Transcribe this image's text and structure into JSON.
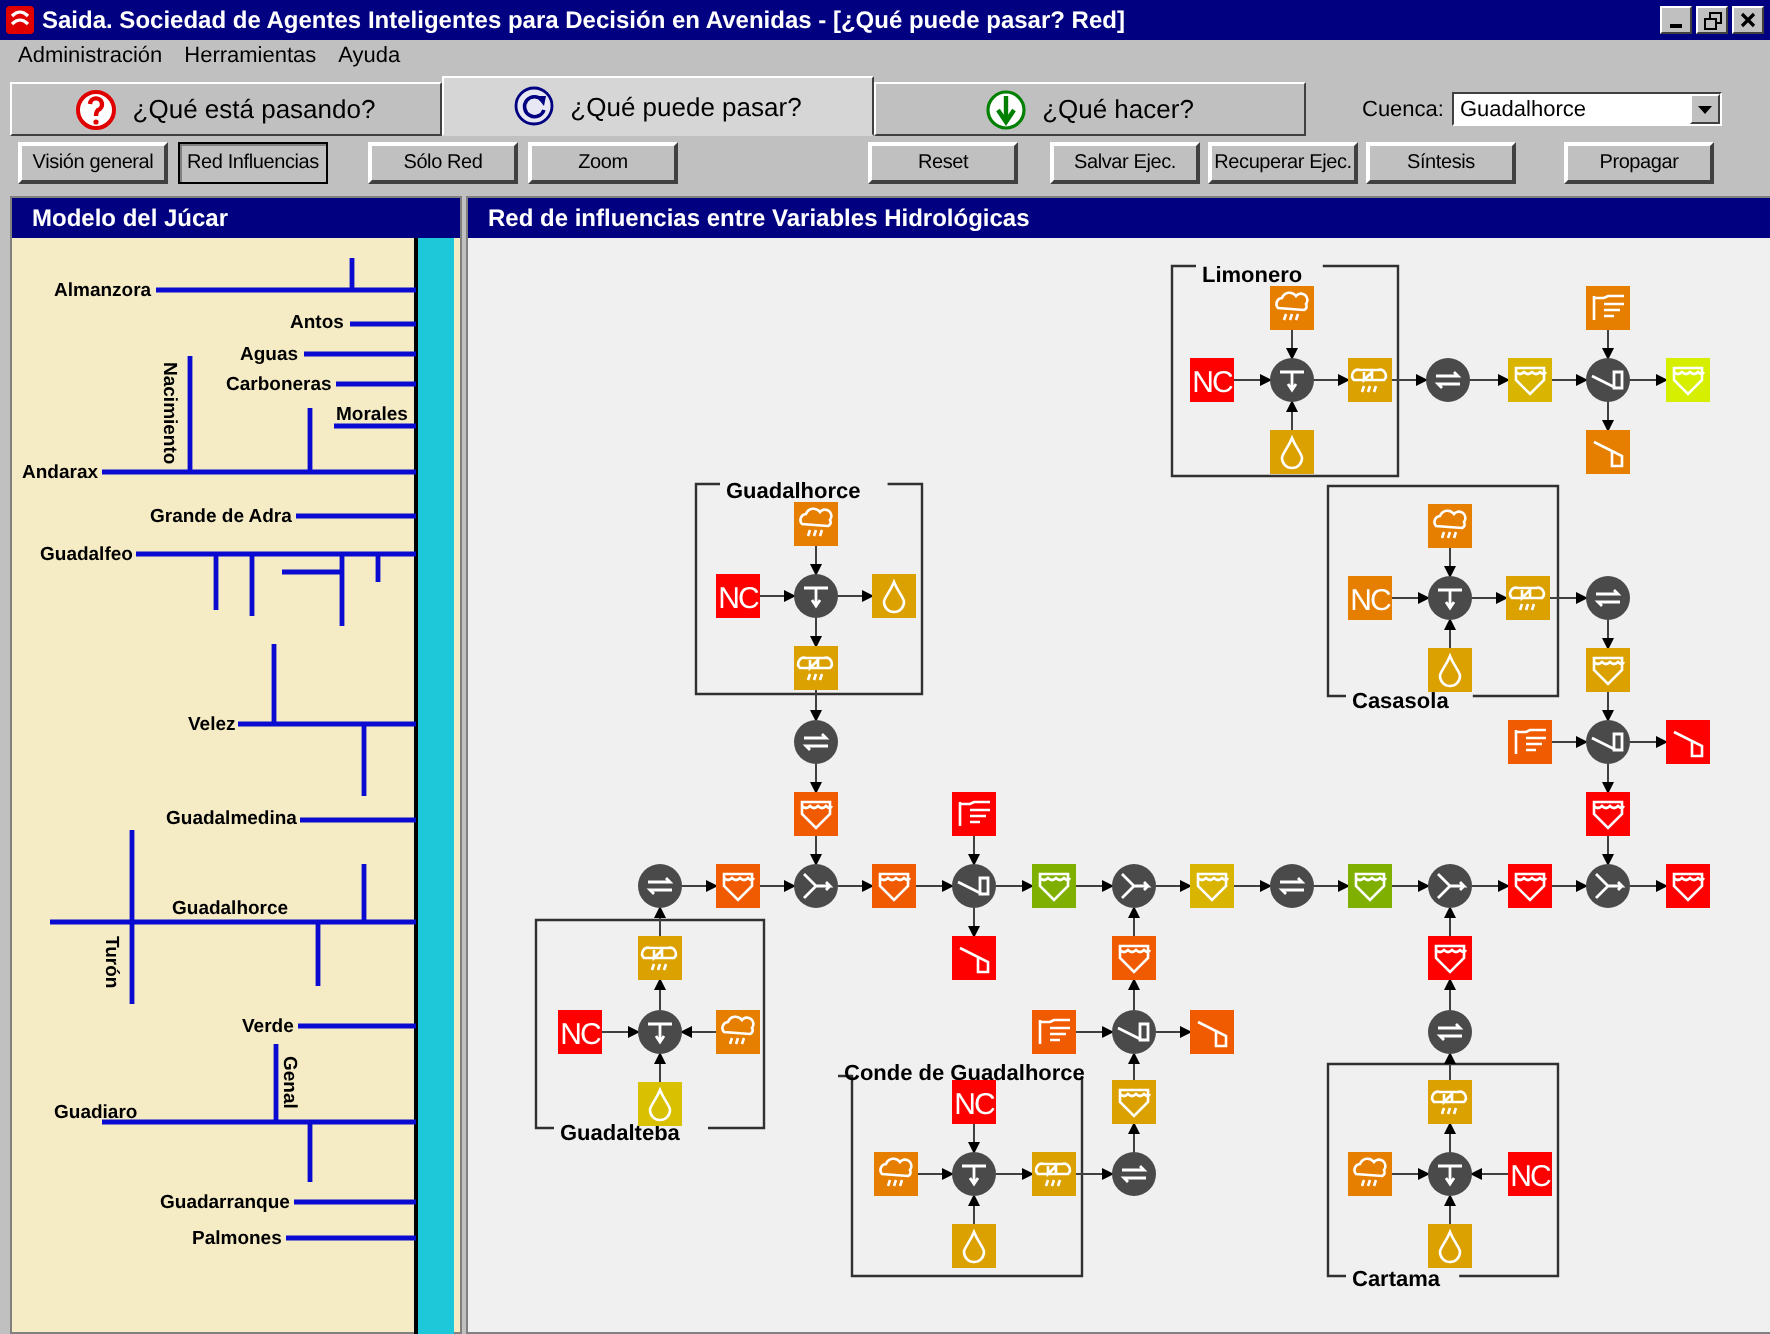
{
  "window": {
    "title": "Saida. Sociedad de Agentes Inteligentes para Decisión en Avenidas - [¿Qué puede pasar? Red]"
  },
  "menu": [
    "Administración",
    "Herramientas",
    "Ayuda"
  ],
  "tabs": [
    {
      "label": "¿Qué está pasando?",
      "selected": false
    },
    {
      "label": "¿Qué puede pasar?",
      "selected": true
    },
    {
      "label": "¿Qué hacer?",
      "selected": false
    }
  ],
  "basin": {
    "label": "Cuenca:",
    "value": "Guadalhorce"
  },
  "toolbar": [
    {
      "label": "Visión general",
      "pressed": false
    },
    {
      "label": "Red Influencias",
      "pressed": true
    },
    {
      "label": "Sólo Red",
      "pressed": false
    },
    {
      "label": "Zoom",
      "pressed": false
    },
    {
      "label": "Reset",
      "pressed": false
    },
    {
      "label": "Salvar Ejec.",
      "pressed": false
    },
    {
      "label": "Recuperar Ejec.",
      "pressed": false
    },
    {
      "label": "Síntesis",
      "pressed": false
    },
    {
      "label": "Propagar",
      "pressed": false
    }
  ],
  "model_panel": {
    "title": "Modelo del Júcar",
    "rivers": [
      "Almanzora",
      "Antos",
      "Aguas",
      "Carboneras",
      "Nacimiento",
      "Morales",
      "Andarax",
      "Grande de Adra",
      "Guadalfeo",
      "Velez",
      "Guadalmedina",
      "Guadalhorce",
      "Turón",
      "Verde",
      "Genal",
      "Guadiaro",
      "Guadarranque",
      "Palmones"
    ]
  },
  "network_panel": {
    "title": "Red de influencias entre Variables Hidrológicas",
    "subbasins": [
      "Limonero",
      "Guadalhorce",
      "Casasola",
      "Guadalteba",
      "Conde de Guadalhorce",
      "Cartama"
    ],
    "nodes": [
      {
        "kind": "rain",
        "color": "#e67e00"
      },
      {
        "kind": "nc",
        "color": "#ff0000",
        "label": "NC"
      },
      {
        "kind": "runoff"
      },
      {
        "kind": "flow",
        "color": "#dba100"
      },
      {
        "kind": "drop",
        "color": "#dba100"
      },
      {
        "kind": "exchange"
      },
      {
        "kind": "reservoir",
        "color": "#d9b400"
      },
      {
        "kind": "hand",
        "color": "#e67e00"
      },
      {
        "kind": "dam"
      },
      {
        "kind": "reservoir",
        "color": "#d6ee00"
      },
      {
        "kind": "spill",
        "color": "#e67e00"
      },
      {
        "kind": "rain",
        "color": "#e67e00"
      },
      {
        "kind": "nc",
        "color": "#e67e00",
        "label": "NC"
      },
      {
        "kind": "runoff"
      },
      {
        "kind": "flow",
        "color": "#dba100"
      },
      {
        "kind": "drop",
        "color": "#dba100"
      },
      {
        "kind": "exchange"
      },
      {
        "kind": "reservoir",
        "color": "#dba100"
      },
      {
        "kind": "hand",
        "color": "#f05a00"
      },
      {
        "kind": "dam"
      },
      {
        "kind": "spill",
        "color": "#ff0000"
      },
      {
        "kind": "reservoir",
        "color": "#ff0000"
      },
      {
        "kind": "rain",
        "color": "#e67e00"
      },
      {
        "kind": "nc",
        "color": "#ff0000",
        "label": "NC"
      },
      {
        "kind": "runoff"
      },
      {
        "kind": "drop",
        "color": "#dba100"
      },
      {
        "kind": "flow",
        "color": "#dba100"
      },
      {
        "kind": "exchange"
      },
      {
        "kind": "reservoir",
        "color": "#f05a00"
      },
      {
        "kind": "exchange"
      },
      {
        "kind": "reservoir",
        "color": "#f05a00"
      },
      {
        "kind": "junction"
      },
      {
        "kind": "reservoir",
        "color": "#f05a00"
      },
      {
        "kind": "hand",
        "color": "#ff0000"
      },
      {
        "kind": "dam"
      },
      {
        "kind": "spill",
        "color": "#ff0000"
      },
      {
        "kind": "reservoir",
        "color": "#7fb000"
      },
      {
        "kind": "junction"
      },
      {
        "kind": "reservoir",
        "color": "#d9b400"
      },
      {
        "kind": "exchange"
      },
      {
        "kind": "reservoir",
        "color": "#7fb000"
      },
      {
        "kind": "junction"
      },
      {
        "kind": "reservoir",
        "color": "#ff0000"
      },
      {
        "kind": "junction"
      },
      {
        "kind": "reservoir",
        "color": "#ff0000"
      },
      {
        "kind": "flow",
        "color": "#dba100"
      },
      {
        "kind": "nc",
        "color": "#ff0000",
        "label": "NC"
      },
      {
        "kind": "runoff"
      },
      {
        "kind": "rain",
        "color": "#e67e00"
      },
      {
        "kind": "drop",
        "color": "#d9c000"
      },
      {
        "kind": "nc",
        "color": "#ff0000",
        "label": "NC"
      },
      {
        "kind": "rain",
        "color": "#e67e00"
      },
      {
        "kind": "runoff"
      },
      {
        "kind": "flow",
        "color": "#dba100"
      },
      {
        "kind": "drop",
        "color": "#dba100"
      },
      {
        "kind": "exchange"
      },
      {
        "kind": "reservoir",
        "color": "#dba100"
      },
      {
        "kind": "hand",
        "color": "#f05a00"
      },
      {
        "kind": "dam"
      },
      {
        "kind": "spill",
        "color": "#f05a00"
      },
      {
        "kind": "reservoir",
        "color": "#f05a00"
      },
      {
        "kind": "flow",
        "color": "#dba100"
      },
      {
        "kind": "rain",
        "color": "#e67e00"
      },
      {
        "kind": "runoff"
      },
      {
        "kind": "nc",
        "color": "#ff0000",
        "label": "NC"
      },
      {
        "kind": "drop",
        "color": "#dba100"
      },
      {
        "kind": "exchange"
      },
      {
        "kind": "reservoir",
        "color": "#ff0000"
      }
    ]
  }
}
